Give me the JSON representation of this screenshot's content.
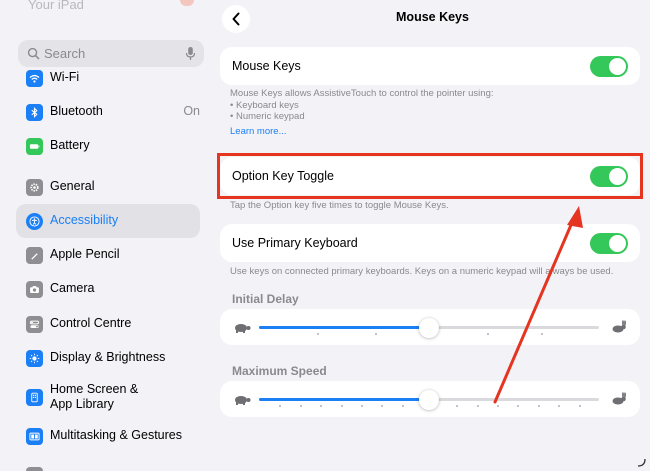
{
  "sidebar": {
    "ghost_header": "Your iPad",
    "search_placeholder": "Search",
    "items": [
      {
        "label": "Wi-Fi",
        "value": "",
        "icon": "wifi-icon",
        "color": "#1b7ff5"
      },
      {
        "label": "Bluetooth",
        "value": "On",
        "icon": "bluetooth-icon",
        "color": "#1b7ff5"
      },
      {
        "label": "Battery",
        "value": "",
        "icon": "battery-icon",
        "color": "#34c759"
      },
      {
        "label": "General",
        "value": "",
        "icon": "gear-icon",
        "color": "#8e8e93"
      },
      {
        "label": "Accessibility",
        "value": "",
        "icon": "accessibility-icon",
        "color": "#1b7ff5"
      },
      {
        "label": "Apple Pencil",
        "value": "",
        "icon": "pencil-icon",
        "color": "#8e8e93"
      },
      {
        "label": "Camera",
        "value": "",
        "icon": "camera-icon",
        "color": "#8e8e93"
      },
      {
        "label": "Control Centre",
        "value": "",
        "icon": "control-centre-icon",
        "color": "#8e8e93"
      },
      {
        "label": "Display & Brightness",
        "value": "",
        "icon": "sun-icon",
        "color": "#1b7ff5"
      },
      {
        "label_line1": "Home Screen &",
        "label_line2": "App Library",
        "value": "",
        "icon": "home-screen-icon",
        "color": "#1b7ff5"
      },
      {
        "label": "Multitasking & Gestures",
        "value": "",
        "icon": "multitasking-icon",
        "color": "#1b7ff5"
      }
    ],
    "active_item": "Accessibility"
  },
  "header": {
    "title": "Mouse Keys"
  },
  "main": {
    "mouse_keys": {
      "label": "Mouse Keys",
      "enabled": true
    },
    "mouse_keys_footnote_line1": "Mouse Keys allows AssistiveTouch to control the pointer using:",
    "mouse_keys_footnote_line2": "•  Keyboard keys",
    "mouse_keys_footnote_line3": "•  Numeric keypad",
    "learn_more": "Learn more...",
    "option_key_toggle": {
      "label": "Option Key Toggle",
      "enabled": true
    },
    "option_key_footnote": "Tap the Option key five times to toggle Mouse Keys.",
    "use_primary_keyboard": {
      "label": "Use Primary Keyboard",
      "enabled": true
    },
    "primary_keyboard_footnote": "Use keys on connected primary keyboards. Keys on a numeric keypad will always be used.",
    "initial_delay": {
      "header": "Initial Delay",
      "value_fraction": 0.5
    },
    "maximum_speed": {
      "header": "Maximum Speed",
      "value_fraction": 0.5
    }
  },
  "colors": {
    "accent": "#1b7ff5",
    "toggle_on": "#34c759",
    "annotation": "#e5341f"
  }
}
